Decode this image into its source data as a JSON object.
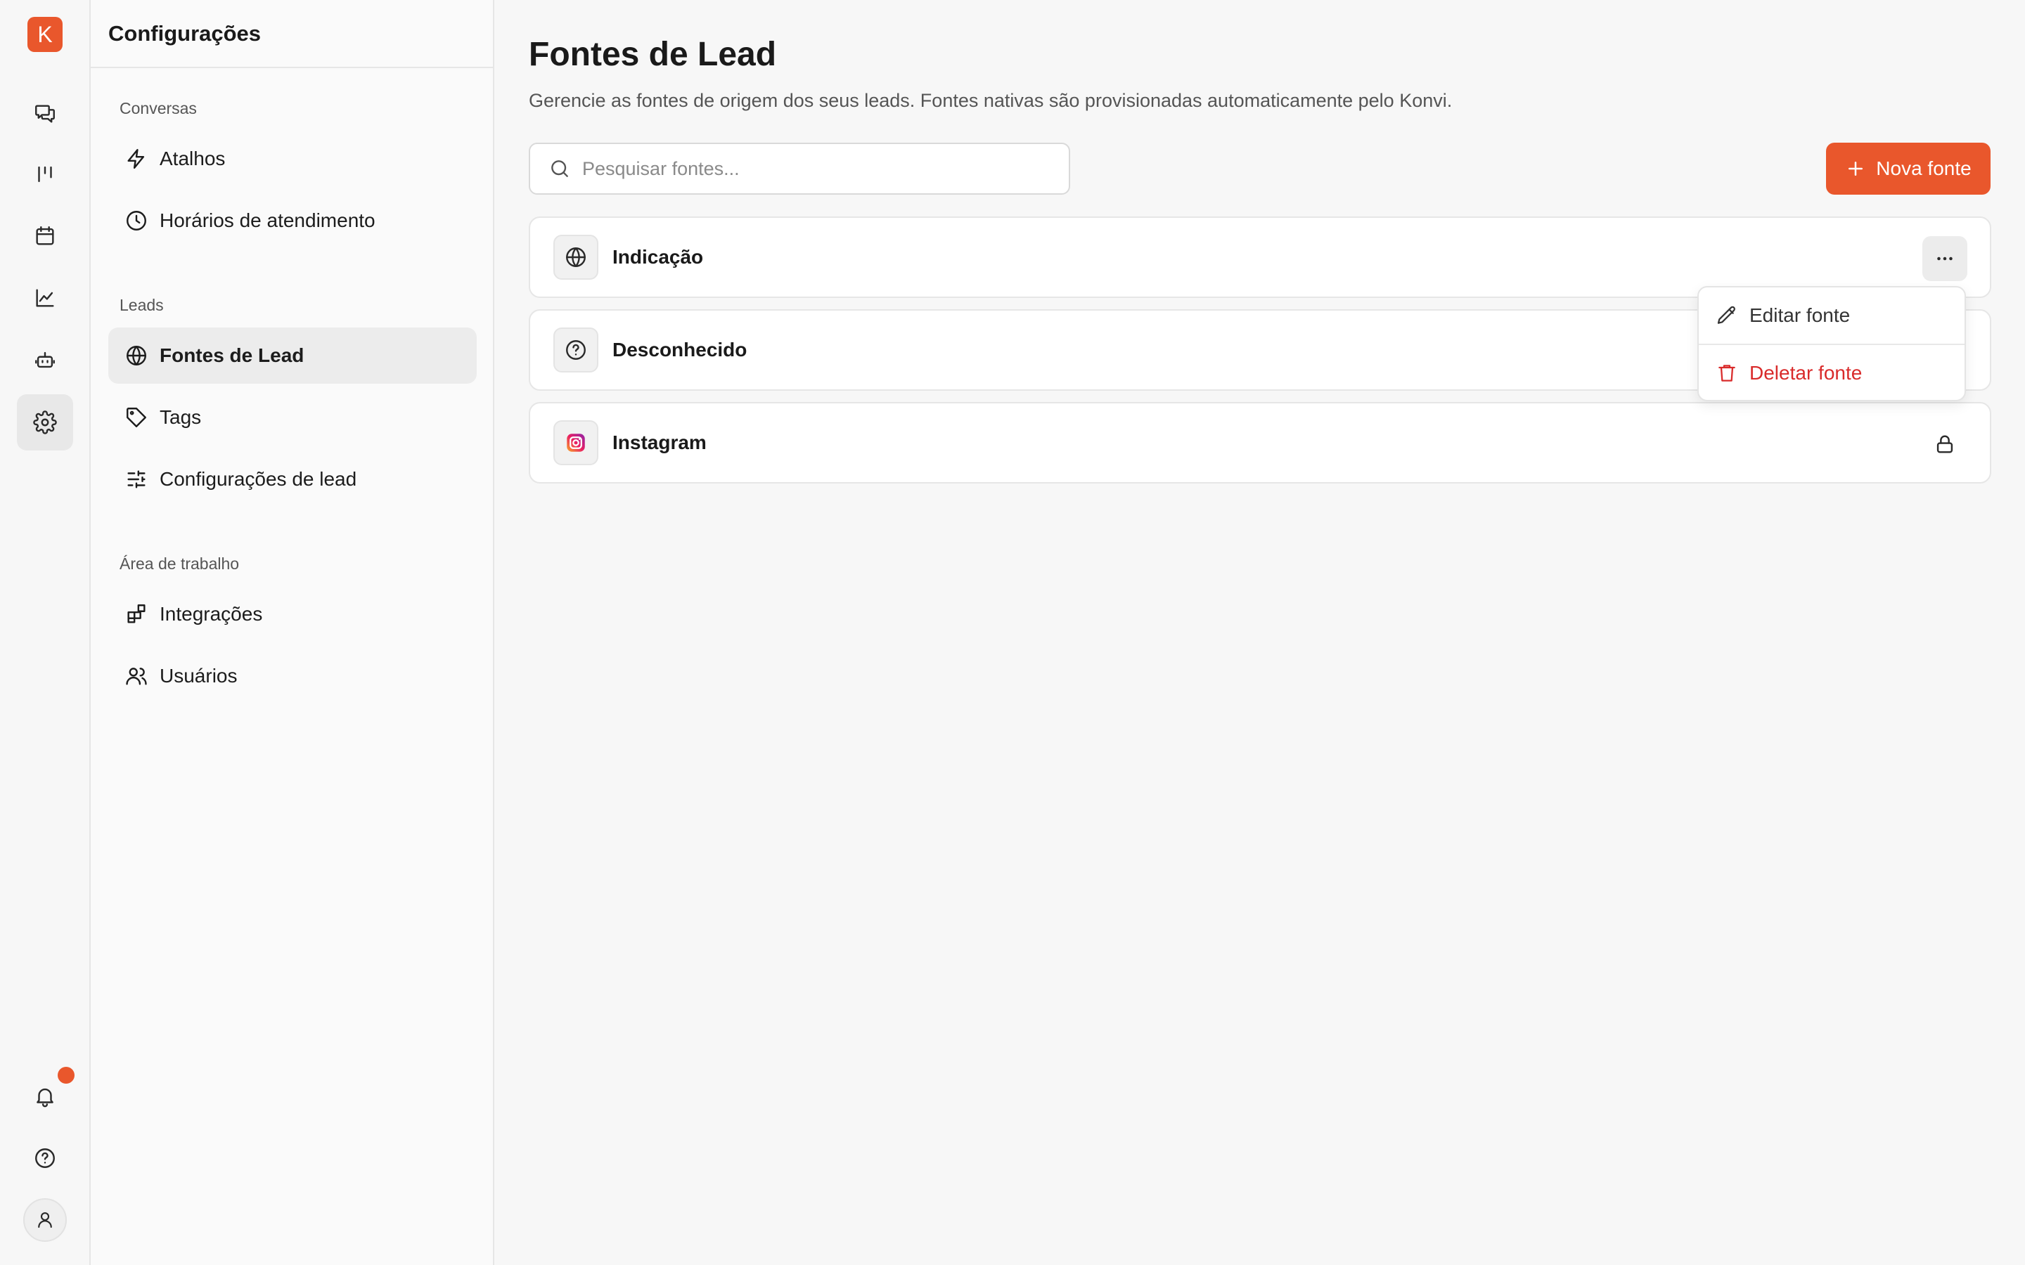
{
  "app": {
    "logo_letter": "K",
    "accent_color": "#e9572c"
  },
  "rail": {
    "items": [
      {
        "icon": "chat-icon"
      },
      {
        "icon": "kanban-icon"
      },
      {
        "icon": "calendar-icon"
      },
      {
        "icon": "chart-icon"
      },
      {
        "icon": "bot-icon"
      },
      {
        "icon": "gear-icon",
        "active": true
      }
    ],
    "bottom": [
      {
        "icon": "bell-icon",
        "has_notification": true
      },
      {
        "icon": "help-icon"
      },
      {
        "icon": "user-icon"
      }
    ]
  },
  "sidebar": {
    "title": "Configurações",
    "sections": [
      {
        "label": "Conversas",
        "items": [
          {
            "label": "Atalhos",
            "icon": "zap-icon"
          },
          {
            "label": "Horários de atendimento",
            "icon": "clock-icon"
          }
        ]
      },
      {
        "label": "Leads",
        "items": [
          {
            "label": "Fontes de Lead",
            "icon": "globe-icon",
            "active": true
          },
          {
            "label": "Tags",
            "icon": "tag-icon"
          },
          {
            "label": "Configurações de lead",
            "icon": "sliders-icon"
          }
        ]
      },
      {
        "label": "Área de trabalho",
        "items": [
          {
            "label": "Integrações",
            "icon": "blocks-icon"
          },
          {
            "label": "Usuários",
            "icon": "users-icon"
          }
        ]
      }
    ]
  },
  "main": {
    "title": "Fontes de Lead",
    "description": "Gerencie as fontes de origem dos seus leads. Fontes nativas são provisionadas automaticamente pelo Konvi.",
    "search": {
      "placeholder": "Pesquisar fontes...",
      "value": ""
    },
    "new_button_label": "Nova fonte",
    "sources": [
      {
        "name": "Indicação",
        "icon": "globe-icon",
        "action": "more-icon"
      },
      {
        "name": "Desconhecido",
        "icon": "help-circle-icon",
        "action": "more-icon"
      },
      {
        "name": "Instagram",
        "icon": "instagram-icon",
        "action": "lock-icon"
      }
    ]
  },
  "dropdown": {
    "items": [
      {
        "label": "Editar fonte",
        "icon": "pencil-icon"
      },
      {
        "label": "Deletar fonte",
        "icon": "trash-icon",
        "color": "#d92b2b"
      }
    ]
  }
}
